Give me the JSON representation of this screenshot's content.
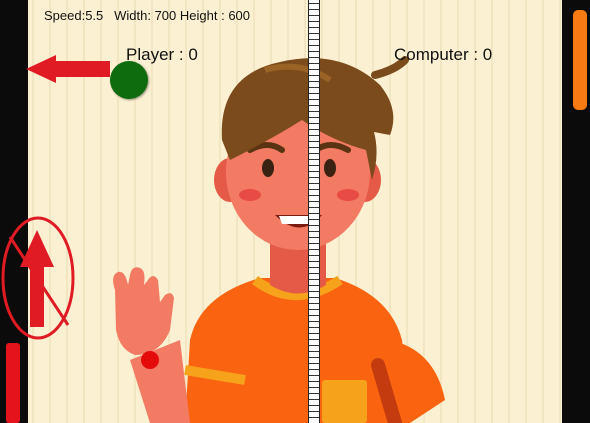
{
  "hud": {
    "speed_text": "Speed:5.5",
    "width_text": "Width: 700",
    "height_text": "Height : 600"
  },
  "scores": {
    "player_label": "Player : 0",
    "computer_label": "Computer : 0"
  },
  "colors": {
    "background": "#fbf1d2",
    "wall": "#0b0b0b",
    "ball": "#0e6b0e",
    "player_paddle": "#e5141a",
    "computer_paddle": "#f77a12",
    "arrow": "#e01b24"
  },
  "icons": {
    "direction_arrow": "left-arrow-icon",
    "disabled_up": "no-up-arrow-icon"
  }
}
